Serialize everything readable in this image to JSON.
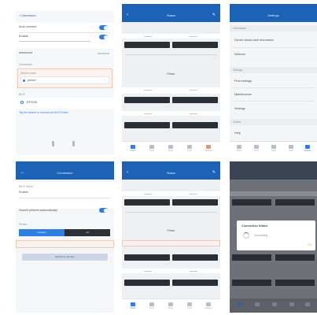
{
  "panel1": {
    "title": "Connection",
    "rows": [
      "Auto connect",
      "Enable",
      "Advanced"
    ],
    "advanced_value": "Advanced",
    "section_label": "Connection",
    "field_label": "Device name",
    "field_value": "printer",
    "section2_label": "Wi-Fi",
    "item_value": "EPSON",
    "note": "Tap the device to connect via Wi-Fi Direct"
  },
  "panel2": {
    "title": "Status",
    "center_label": "Printer"
  },
  "panel3": {
    "title": "Settings",
    "sections": [
      {
        "header": "Information",
        "items": [
          "Device status and information",
          "Network"
        ]
      },
      {
        "header": "Settings",
        "items": [
          "Print settings",
          "Maintenance",
          "Settings"
        ]
      },
      {
        "header": "Others",
        "items": [
          "Help"
        ]
      }
    ]
  },
  "panel4": {
    "title": "Connection",
    "rows": [
      "Wi-Fi Direct",
      "Enable",
      "Search printers automatically"
    ],
    "seg_left": "Connect",
    "seg_right": "Off",
    "section_label": "Printer",
    "button_label": "Search for printers"
  },
  "panel5": {
    "title": "Status",
    "center_label": "Printer"
  },
  "panel6": {
    "dialog_title": "Connection Status",
    "dialog_message": "Connecting...",
    "dialog_action": "OK"
  },
  "tabs": [
    "Home",
    "Print",
    "Scan",
    "Copy",
    "Settings"
  ],
  "colors": {
    "primary": "#1c63b7",
    "accent": "#2f7fe0",
    "dark_button": "#2b3037",
    "highlight": "#f0c8b8"
  }
}
